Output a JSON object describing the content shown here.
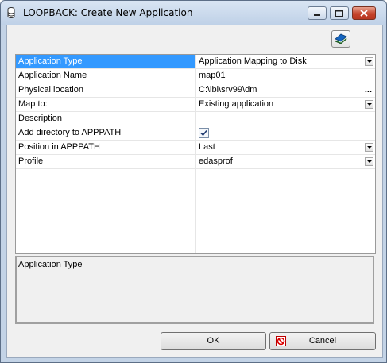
{
  "window": {
    "title": "LOOPBACK: Create New Application"
  },
  "properties": [
    {
      "name": "Application Type",
      "value": "Application Mapping to Disk",
      "control": "dropdown",
      "selected": true
    },
    {
      "name": "Application Name",
      "value": "map01",
      "control": "text"
    },
    {
      "name": "Physical location",
      "value": "C:\\ibi\\srv99\\dm",
      "control": "browse",
      "browse_label": "..."
    },
    {
      "name": "Map to:",
      "value": "Existing application",
      "control": "dropdown"
    },
    {
      "name": "Description",
      "value": "",
      "control": "text"
    },
    {
      "name": "Add directory to APPPATH",
      "value": "",
      "control": "checkbox",
      "checked": true
    },
    {
      "name": "Position in APPPATH",
      "value": "Last",
      "control": "dropdown"
    },
    {
      "name": "Profile",
      "value": "edasprof",
      "control": "dropdown"
    }
  ],
  "description_panel": {
    "text": "Application Type"
  },
  "buttons": {
    "ok": "OK",
    "cancel": "Cancel"
  }
}
